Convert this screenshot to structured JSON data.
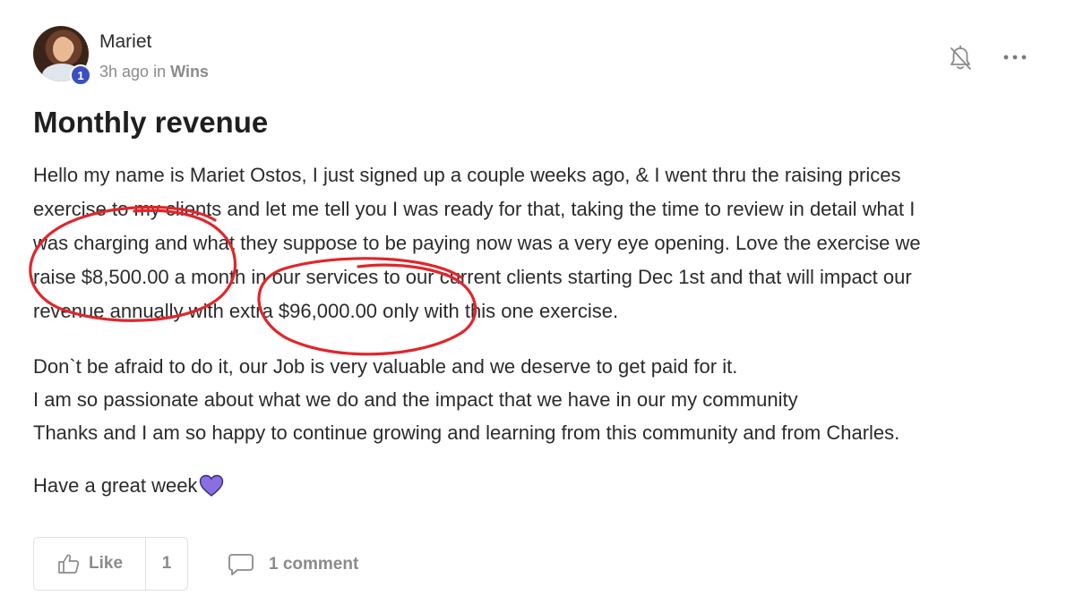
{
  "post": {
    "author": "Mariet",
    "level": "1",
    "time": "3h ago",
    "in_word": "in",
    "category": "Wins",
    "title": "Monthly revenue",
    "body_lines_1": [
      "Hello my name is Mariet Ostos, I just signed up a couple weeks ago, & I went thru the raising prices",
      "exercise to my clients and let me tell you I was ready for that, taking the time to review in detail what I",
      "was charging and what they suppose to be paying now was a very eye opening. Love the exercise we",
      "raise $8,500.00 a month in our services to our current clients starting Dec 1st and that will impact our",
      "revenue annually with extra $96,000.00 only with this one exercise."
    ],
    "body_lines_2": [
      "Don`t be afraid to do it, our Job is very valuable and we deserve to get paid for it.",
      "I am so passionate about what we do and the impact that we have in our my community",
      "Thanks and I am so happy to continue growing and learning from this community and from Charles."
    ],
    "closing": "Have a great week",
    "icons": {
      "notifications": "bell-off-icon",
      "more": "more-icon",
      "like": "thumbs-up-icon",
      "comment": "comment-icon",
      "heart": "purple-heart-icon"
    },
    "annotation_color": "#e0262b"
  },
  "actions": {
    "like_label": "Like",
    "like_count": "1",
    "comment_label": "1 comment"
  }
}
